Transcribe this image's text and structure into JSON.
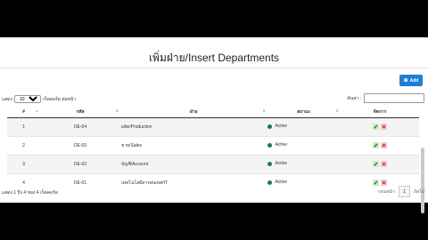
{
  "page": {
    "title": "เพิ่มฝ่าย/Insert Departments"
  },
  "add_button": {
    "label": "Add"
  },
  "length": {
    "prefix": "แสดง",
    "value": "10",
    "suffix": "เร็คคอร์ด ต่อหน้า"
  },
  "search": {
    "label": "ค้นหา :",
    "value": ""
  },
  "table": {
    "headers": [
      "#",
      "รหัส",
      "ฝ่าย",
      "สถานะ",
      "จัดการ"
    ],
    "rows": [
      {
        "num": "1",
        "code": "DE-04",
        "name": "ผลิต/Production",
        "status": "Active"
      },
      {
        "num": "2",
        "code": "DE-03",
        "name": "ขาย/Sales",
        "status": "Active"
      },
      {
        "num": "3",
        "code": "DE-02",
        "name": "บัญชี/Account",
        "status": "Active"
      },
      {
        "num": "4",
        "code": "DE-01",
        "name": "เทคโนโลยีสารสนเทศ/IT",
        "status": "Active"
      }
    ]
  },
  "footer": {
    "info": "แสดง 1 ถึง 4 ของ 4 เร็คคอร์ด",
    "prev": "ก่อนหน้า",
    "page": "1",
    "next": "ถัดไป"
  },
  "colors": {
    "add_button": "#1e7fd8",
    "status_active": "#1d7a3f"
  }
}
